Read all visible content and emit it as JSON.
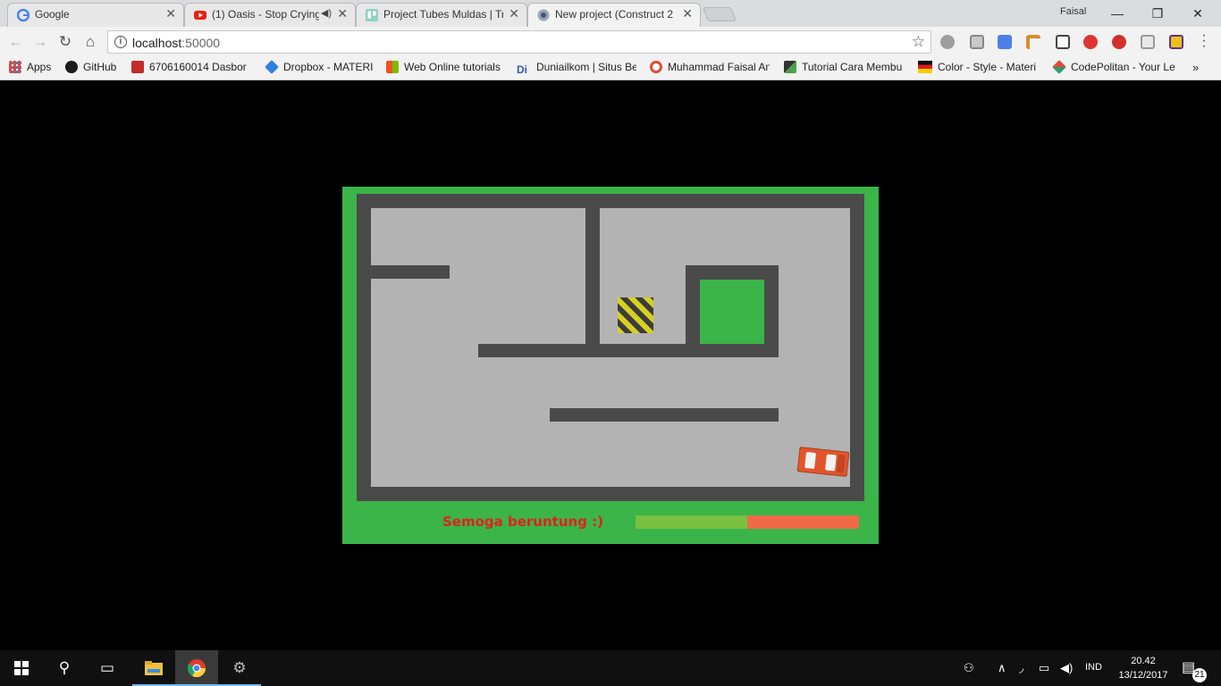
{
  "browser": {
    "tabs": [
      {
        "title": "Google",
        "icon": "google-icon",
        "active": false
      },
      {
        "title": "(1) Oasis - Stop Crying",
        "icon": "youtube-icon",
        "active": false,
        "muted_icon": "speaker-icon"
      },
      {
        "title": "Project Tubes Muldas | Tr",
        "icon": "trello-icon",
        "active": false
      },
      {
        "title": "New project (Construct 2",
        "icon": "construct-icon",
        "active": true
      }
    ],
    "profile_name": "Faisal",
    "window_controls": {
      "minimize": "—",
      "maximize": "❐",
      "close": "✕"
    },
    "address": {
      "host": "localhost",
      "port": ":50000"
    },
    "bookmarks": [
      {
        "label": "Apps",
        "icon": "apps-grid-icon"
      },
      {
        "label": "GitHub",
        "icon": "github-icon"
      },
      {
        "label": "6706160014 Dasbor",
        "icon": "telkom-icon"
      },
      {
        "label": "Dropbox - MATERI",
        "icon": "dropbox-icon"
      },
      {
        "label": "Web Online tutorials",
        "icon": "microsoft-icon"
      },
      {
        "label": "Duniailkom | Situs Be",
        "icon": "duniailkom-icon"
      },
      {
        "label": "Muhammad Faisal An",
        "icon": "circle-icon"
      },
      {
        "label": "Tutorial Cara Membu",
        "icon": "bookmark-icon"
      },
      {
        "label": "Color - Style - Materi",
        "icon": "flag-icon"
      },
      {
        "label": "CodePolitan - Your Le",
        "icon": "codepolitan-icon"
      }
    ],
    "more_bookmarks": "»"
  },
  "game": {
    "status_message": "Semoga beruntung :)",
    "progress": 0.5,
    "colors": {
      "background": "#3bb44a",
      "wall": "#4a4a4a",
      "floor": "#b3b3b3",
      "car": "#e0562a",
      "progress_fill": "#79c141",
      "progress_track": "#f06a48",
      "message": "#e02020"
    }
  },
  "taskbar": {
    "apps": [
      "start-icon",
      "search-icon",
      "task-view-icon",
      "file-explorer-icon",
      "chrome-icon",
      "settings-icon"
    ],
    "language": "IND",
    "time": "20.42",
    "date": "13/12/2017",
    "notifications": "21"
  }
}
